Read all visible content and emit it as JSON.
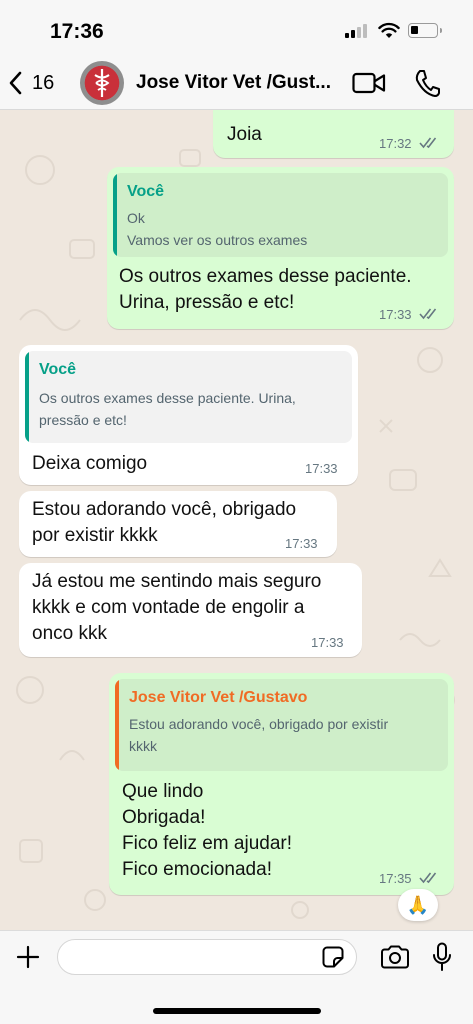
{
  "status_bar": {
    "time": "17:36"
  },
  "header": {
    "back_count": "16",
    "contact_name": "Jose Vitor  Vet /Gust..."
  },
  "messages": [
    {
      "direction": "outgoing",
      "text": "Joia",
      "time": "17:32",
      "status": "read"
    },
    {
      "direction": "outgoing",
      "quote": {
        "author": "Você",
        "text": "Ok\nVamos ver os outros exames"
      },
      "text": "Os outros exames desse paciente.\nUrina, pressão e etc!",
      "time": "17:33",
      "status": "read"
    },
    {
      "direction": "incoming",
      "quote": {
        "author": "Você",
        "text": "Os outros exames desse paciente. Urina,\npressão e etc!"
      },
      "text": "Deixa comigo",
      "time": "17:33"
    },
    {
      "direction": "incoming",
      "text": "Estou adorando você, obrigado\npor existir kkkk",
      "time": "17:33"
    },
    {
      "direction": "incoming",
      "text": "Já estou me sentindo mais seguro\nkkkk e com vontade de engolir a\nonco kkk",
      "time": "17:33"
    },
    {
      "direction": "outgoing",
      "quote": {
        "author": "Jose Vitor  Vet /Gustavo",
        "text": "Estou adorando você, obrigado por existir\nkkkk"
      },
      "text": "Que lindo\nObrigada!\nFico feliz em ajudar!\nFico emocionada!",
      "time": "17:35",
      "status": "read",
      "reaction": "🙏"
    }
  ],
  "composer": {
    "input_value": "",
    "placeholder": ""
  },
  "colors": {
    "outgoing_bubble": "#d9fdd3",
    "incoming_bubble": "#ffffff",
    "chat_background": "#efe7de",
    "quote_self_accent": "#06a088",
    "quote_contact_accent": "#f06b24",
    "read_ticks": "#667781"
  },
  "icons": {
    "back": "chevron-left-icon",
    "video": "video-camera-icon",
    "call": "phone-icon",
    "attach": "plus-icon",
    "sticker": "sticker-icon",
    "camera": "camera-icon",
    "mic": "microphone-icon"
  }
}
